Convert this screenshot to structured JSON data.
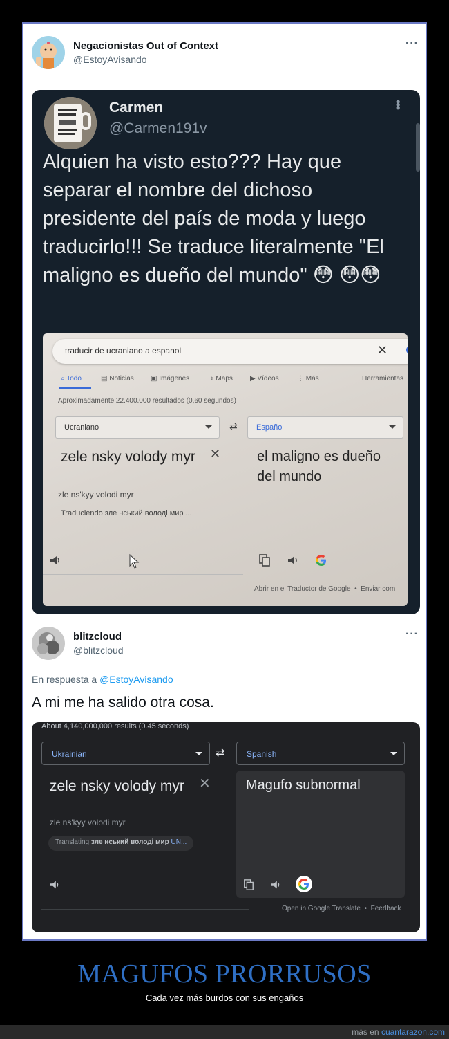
{
  "tweet1": {
    "name": "Negacionistas Out of Context",
    "handle": "@EstoyAvisando",
    "more": "···"
  },
  "screenshot1": {
    "name": "Carmen",
    "handle": "@Carmen191v",
    "text": "Alquien ha visto esto??? Hay que separar el nombre del dichoso presidente del país de moda y luego traducirlo!!! Se traduce literalmente \"El maligno es dueño del mundo\" 😳 😳😳",
    "photo": {
      "search": "traducir de ucraniano a espanol",
      "tabs": [
        "Todo",
        "Noticias",
        "Imágenes",
        "Maps",
        "Vídeos",
        "Más",
        "Herramientas"
      ],
      "results": "Aproximadamente 22.400.000 resultados (0,60 segundos)",
      "source_lang": "Ucraniano",
      "target_lang": "Español",
      "source_text": "zele nsky volody myr",
      "transliteration": "zle ns'kyy volodi myr",
      "translating": "Traduciendo зле нський володі мир ...",
      "target_text": "el maligno es dueño del mundo",
      "footer_open": "Abrir en el Traductor de Google",
      "footer_send": "Enviar com"
    }
  },
  "tweet2": {
    "name": "blitzcloud",
    "handle": "@blitzcloud",
    "more": "···",
    "reply_prefix": "En respuesta a",
    "reply_handle": "@EstoyAvisando",
    "text": "A mi me ha salido otra cosa."
  },
  "screenshot2": {
    "results": "About 4,140,000,000 results (0.45 seconds)",
    "source_lang": "Ukrainian",
    "target_lang": "Spanish",
    "source_text": "zele nsky volody myr",
    "transliteration": "zle ns'kyy volodi myr",
    "translating_label": "Translating",
    "translating_word": "зле нський володі мир",
    "translating_more": "UN...",
    "target_text": "Magufo subnormal",
    "footer_open": "Open in Google Translate",
    "footer_dot": "•",
    "footer_feedback": "Feedback"
  },
  "caption": {
    "title": "MAGUFOS PRORRUSOS",
    "subtitle": "Cada vez más burdos con sus engaños",
    "credit_prefix": "más en",
    "credit_link": "cuantarazon.com"
  },
  "colors": {
    "accent_link": "#1d9bf0",
    "caption_blue": "#2f6fc4",
    "twitter_dark": "#15202b",
    "google_dark": "#202124"
  }
}
